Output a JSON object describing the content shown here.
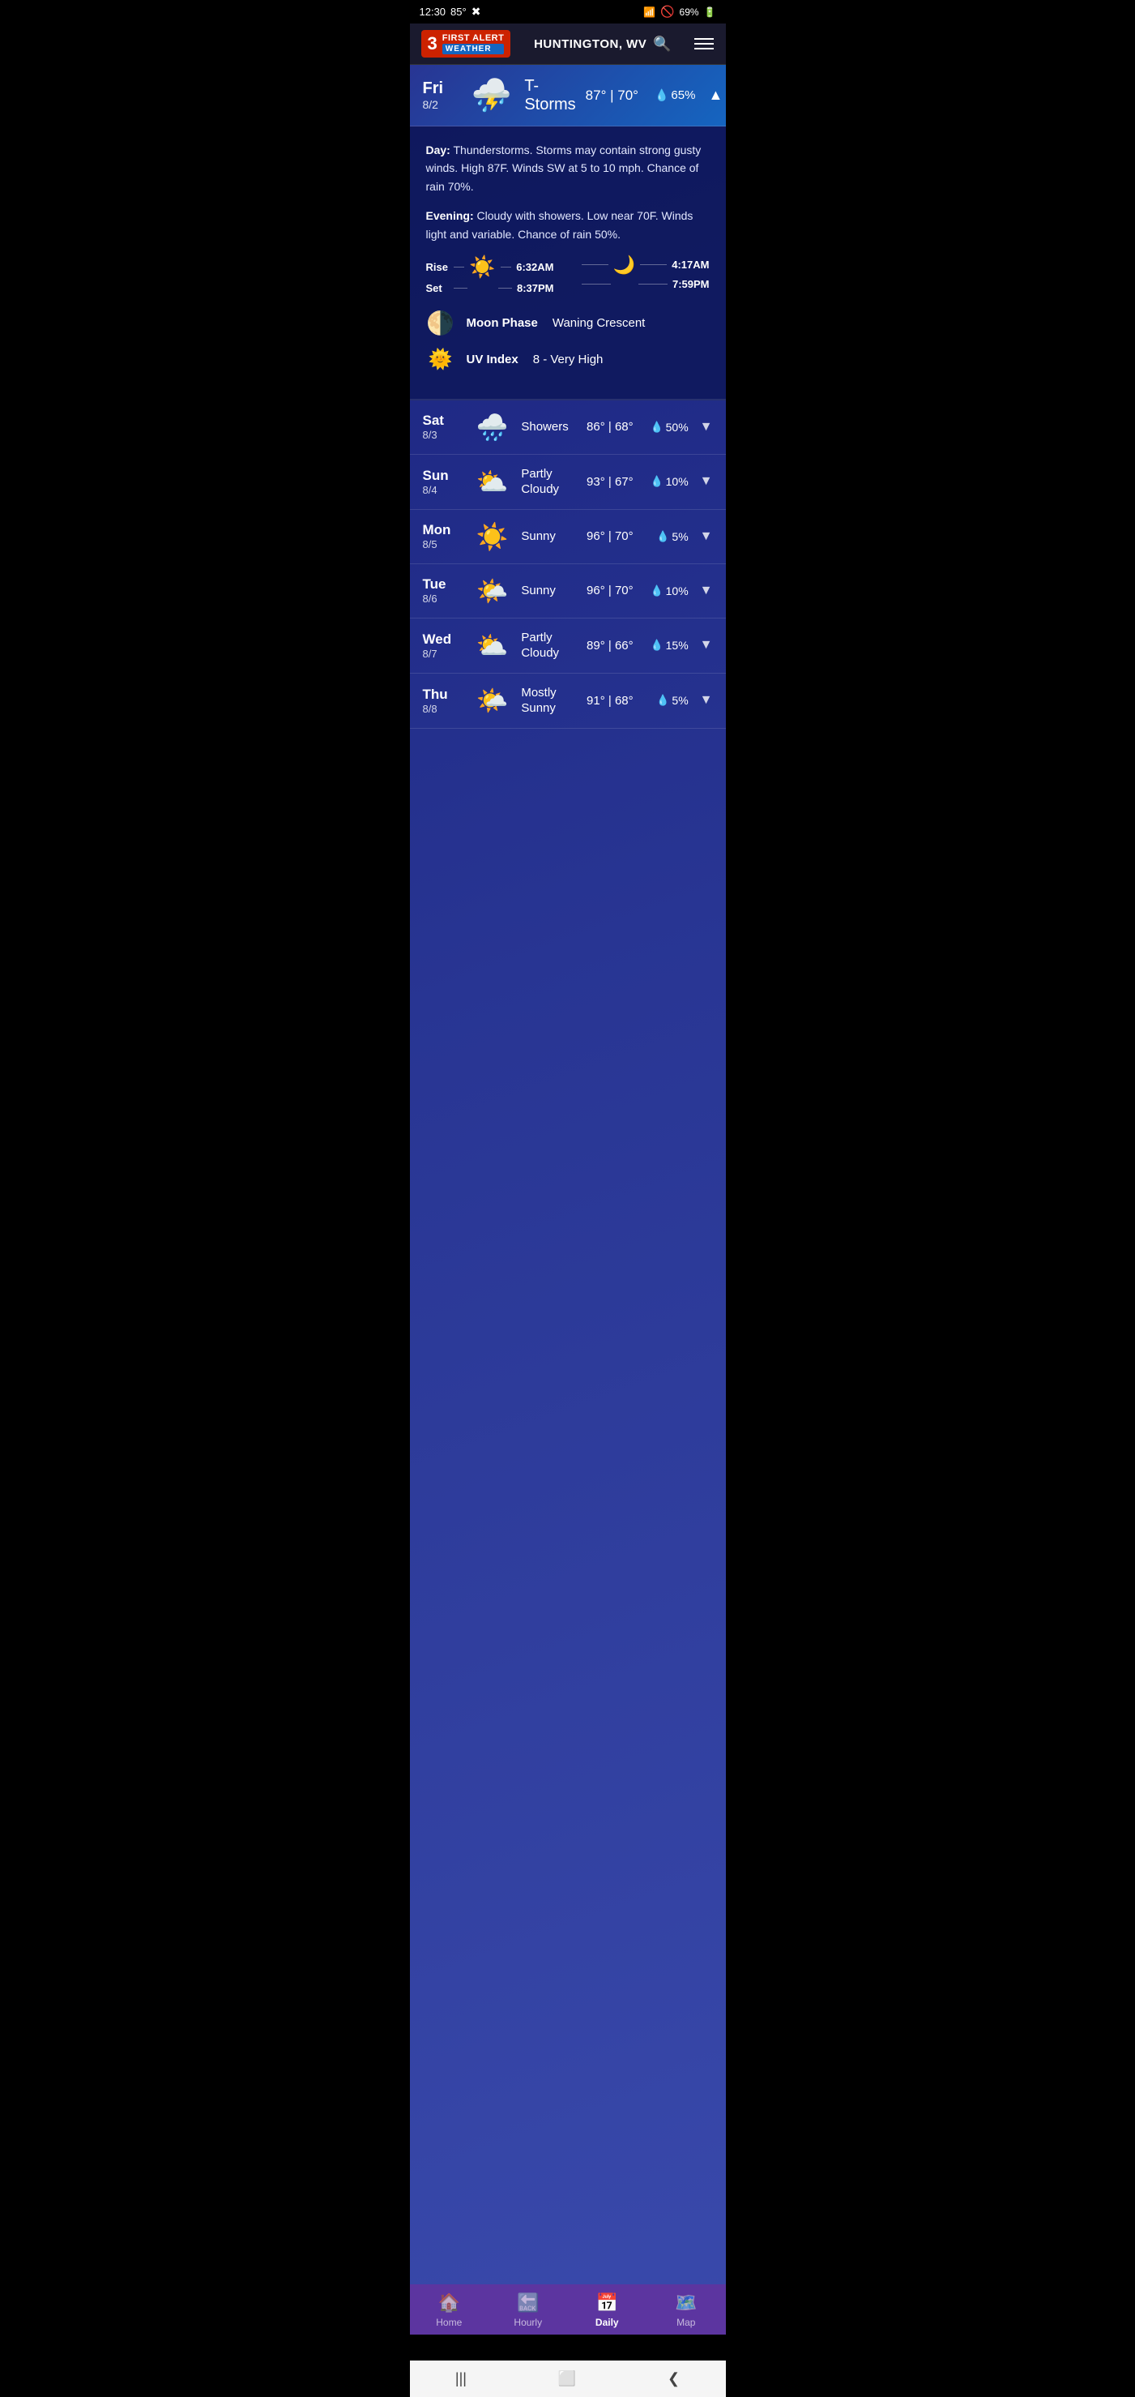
{
  "statusBar": {
    "time": "12:30",
    "temp": "85°",
    "battery": "69%",
    "icons": [
      "wifi",
      "no-entry",
      "battery"
    ]
  },
  "header": {
    "logoNumber": "3",
    "logoFirstAlert": "FIRST ALERT",
    "logoWeather": "WEATHER",
    "location": "HUNTINGTON, WV"
  },
  "featuredDay": {
    "dayName": "Fri",
    "dayDate": "8/2",
    "condition": "T-Storms",
    "highTemp": "87°",
    "lowTemp": "70°",
    "separator": "|",
    "precip": "65%"
  },
  "detailPanel": {
    "dayText": "Day:",
    "dayDescription": "Thunderstorms. Storms may contain strong gusty winds. High 87F. Winds SW at 5 to 10 mph. Chance of rain 70%.",
    "eveningText": "Evening:",
    "eveningDescription": "Cloudy with showers. Low near 70F. Winds light and variable. Chance of rain 50%.",
    "sunRise": "Rise",
    "sunSet": "Set",
    "sunriseTime": "6:32AM",
    "sunsetTime": "8:37PM",
    "moonriseTime": "4:17AM",
    "moonsetTime": "7:59PM",
    "moonPhaseLabel": "Moon Phase",
    "moonPhaseValue": "Waning Crescent",
    "uvLabel": "UV Index",
    "uvValue": "8 - Very High"
  },
  "forecast": [
    {
      "dayName": "Sat",
      "dayDate": "8/3",
      "condition": "Showers",
      "icon": "🌧️",
      "highTemp": "86°",
      "lowTemp": "68°",
      "precip": "50%"
    },
    {
      "dayName": "Sun",
      "dayDate": "8/4",
      "condition": "Partly Cloudy",
      "icon": "⛅",
      "highTemp": "93°",
      "lowTemp": "67°",
      "precip": "10%"
    },
    {
      "dayName": "Mon",
      "dayDate": "8/5",
      "condition": "Sunny",
      "icon": "☀️",
      "highTemp": "96°",
      "lowTemp": "70°",
      "precip": "5%"
    },
    {
      "dayName": "Tue",
      "dayDate": "8/6",
      "condition": "Sunny",
      "icon": "🌤️",
      "highTemp": "96°",
      "lowTemp": "70°",
      "precip": "10%"
    },
    {
      "dayName": "Wed",
      "dayDate": "8/7",
      "condition": "Partly Cloudy",
      "icon": "⛅",
      "highTemp": "89°",
      "lowTemp": "66°",
      "precip": "15%"
    },
    {
      "dayName": "Thu",
      "dayDate": "8/8",
      "condition": "Mostly Sunny",
      "icon": "🌤️",
      "highTemp": "91°",
      "lowTemp": "68°",
      "precip": "5%"
    }
  ],
  "bottomNav": [
    {
      "label": "Home",
      "icon": "🏠",
      "active": false
    },
    {
      "label": "Hourly",
      "icon": "🔙",
      "active": false
    },
    {
      "label": "Daily",
      "icon": "📅",
      "active": true
    },
    {
      "label": "Map",
      "icon": "🗺️",
      "active": false
    }
  ],
  "androidNav": {
    "backIcon": "❮",
    "homeIcon": "⬜",
    "menuIcon": "|||"
  }
}
